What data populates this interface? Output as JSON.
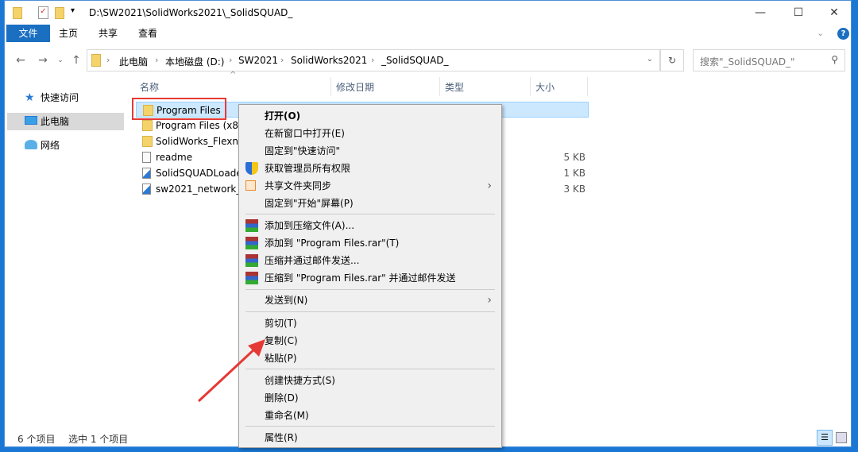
{
  "window": {
    "title": "D:\\SW2021\\SolidWorks2021\\_SolidSQUAD_",
    "minimize": "—",
    "maximize": "☐",
    "close": "✕"
  },
  "ribbon": {
    "tabs": [
      "文件",
      "主页",
      "共享",
      "查看"
    ],
    "help": "?"
  },
  "address": {
    "crumbs": [
      "此电脑",
      "本地磁盘 (D:)",
      "SW2021",
      "SolidWorks2021",
      "_SolidSQUAD_"
    ],
    "search_placeholder": "搜索\"_SolidSQUAD_\""
  },
  "sidebar": {
    "items": [
      {
        "label": "快速访问",
        "icon": "star-icon"
      },
      {
        "label": "此电脑",
        "icon": "computer-icon"
      },
      {
        "label": "网络",
        "icon": "network-icon"
      }
    ]
  },
  "columns": [
    "名称",
    "修改日期",
    "类型",
    "大小"
  ],
  "files": [
    {
      "name": "Program Files",
      "type": "folder",
      "size": ""
    },
    {
      "name": "Program Files (x86)",
      "type": "folder",
      "size": ""
    },
    {
      "name": "SolidWorks_Flexnet_Server",
      "type": "folder",
      "size": ""
    },
    {
      "name": "readme",
      "type": "text",
      "size": "5 KB"
    },
    {
      "name": "SolidSQUADLoaderEnabler",
      "type": "reg",
      "size": "1 KB"
    },
    {
      "name": "sw2021_network_serial_numbers",
      "type": "reg",
      "size": "3 KB"
    }
  ],
  "context_menu": {
    "items": [
      "打开(O)",
      "在新窗口中打开(E)",
      "固定到\"快速访问\"",
      "获取管理员所有权限",
      "共享文件夹同步",
      "固定到\"开始\"屏幕(P)",
      "添加到压缩文件(A)...",
      "添加到 \"Program Files.rar\"(T)",
      "压缩并通过邮件发送...",
      "压缩到 \"Program Files.rar\" 并通过邮件发送",
      "发送到(N)",
      "剪切(T)",
      "复制(C)",
      "粘贴(P)",
      "创建快捷方式(S)",
      "删除(D)",
      "重命名(M)",
      "属性(R)"
    ]
  },
  "status": {
    "count": "6 个项目",
    "selected": "选中 1 个项目"
  },
  "colors": {
    "accent": "#1a6fc1",
    "selection": "#cce8ff",
    "highlight": "#e53935"
  }
}
